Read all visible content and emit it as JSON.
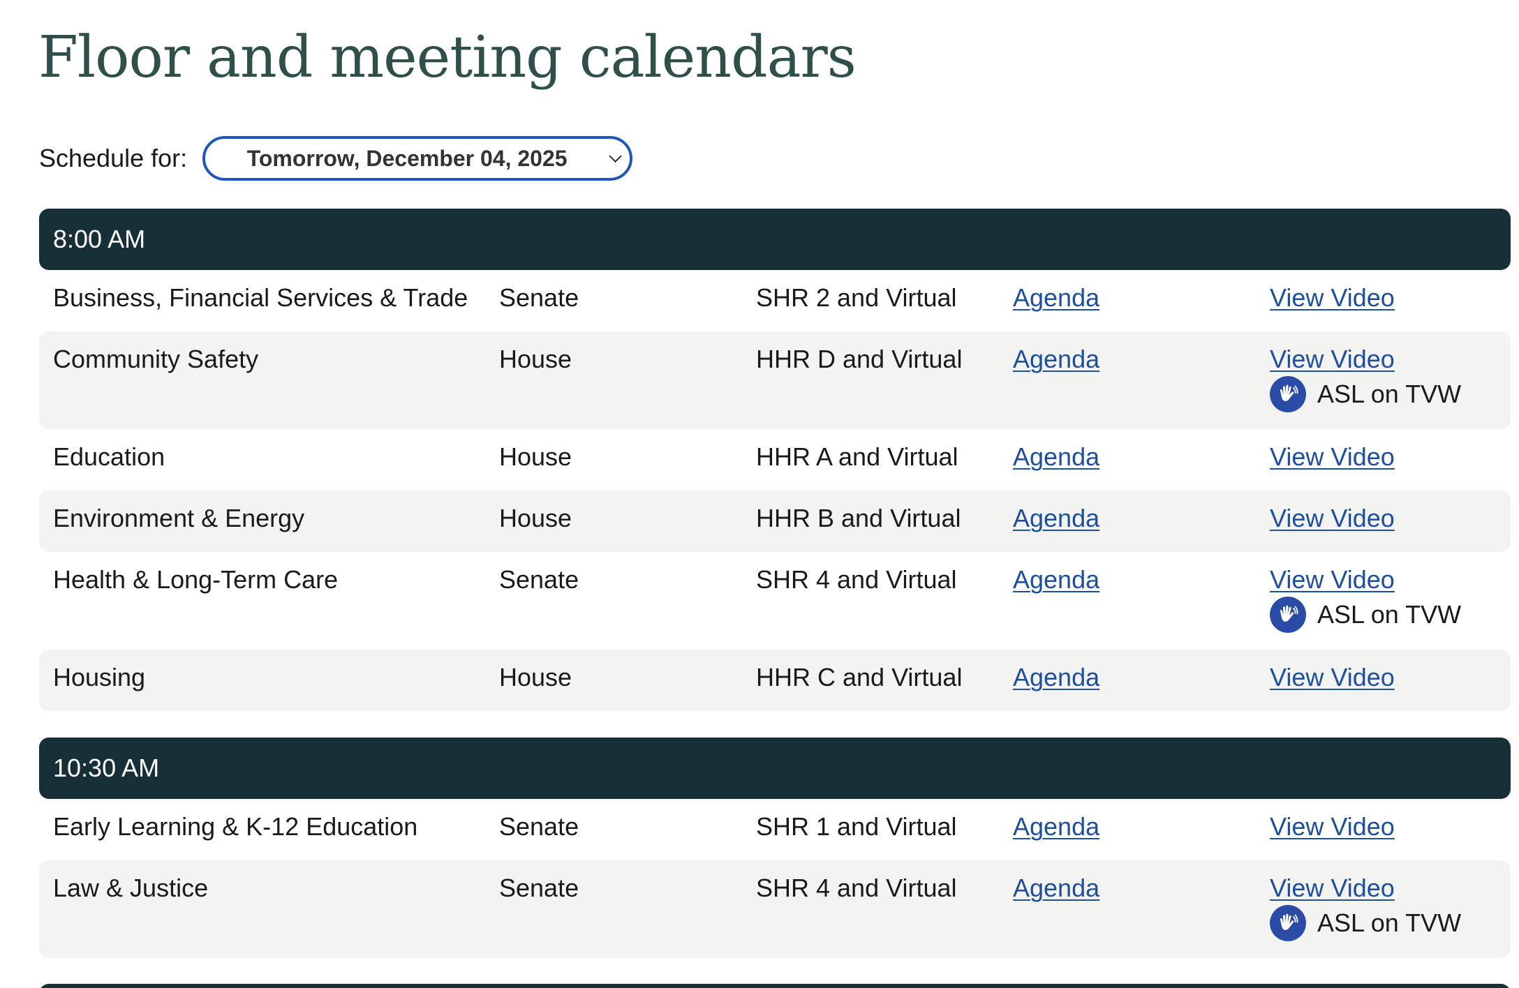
{
  "page": {
    "title": "Floor and meeting calendars"
  },
  "schedule": {
    "label": "Schedule for:",
    "selected_date": "Tomorrow, December 04, 2025"
  },
  "link_labels": {
    "agenda": "Agenda",
    "video": "View Video",
    "asl": "ASL on TVW"
  },
  "icons": {
    "asl": "asl-hands-icon",
    "select": "chevron-down-icon"
  },
  "colors": {
    "title": "#2f4f4b",
    "time_header_bg": "#172f36",
    "link": "#1e4f9c",
    "select_border": "#1f58b8",
    "row_alt_bg": "#f3f3f2",
    "asl_icon_bg": "#2b4ca6"
  },
  "groups": [
    {
      "time": "8:00 AM",
      "meetings": [
        {
          "committee": "Business, Financial Services & Trade",
          "chamber": "Senate",
          "room": "SHR 2 and Virtual",
          "asl": false
        },
        {
          "committee": "Community Safety",
          "chamber": "House",
          "room": "HHR D and Virtual",
          "asl": true
        },
        {
          "committee": "Education",
          "chamber": "House",
          "room": "HHR A and Virtual",
          "asl": false
        },
        {
          "committee": "Environment & Energy",
          "chamber": "House",
          "room": "HHR B and Virtual",
          "asl": false
        },
        {
          "committee": "Health & Long-Term Care",
          "chamber": "Senate",
          "room": "SHR 4 and Virtual",
          "asl": true
        },
        {
          "committee": "Housing",
          "chamber": "House",
          "room": "HHR C and Virtual",
          "asl": false
        }
      ]
    },
    {
      "time": "10:30 AM",
      "meetings": [
        {
          "committee": "Early Learning & K-12 Education",
          "chamber": "Senate",
          "room": "SHR 1 and Virtual",
          "asl": false
        },
        {
          "committee": "Law & Justice",
          "chamber": "Senate",
          "room": "SHR 4 and Virtual",
          "asl": true
        }
      ]
    }
  ]
}
